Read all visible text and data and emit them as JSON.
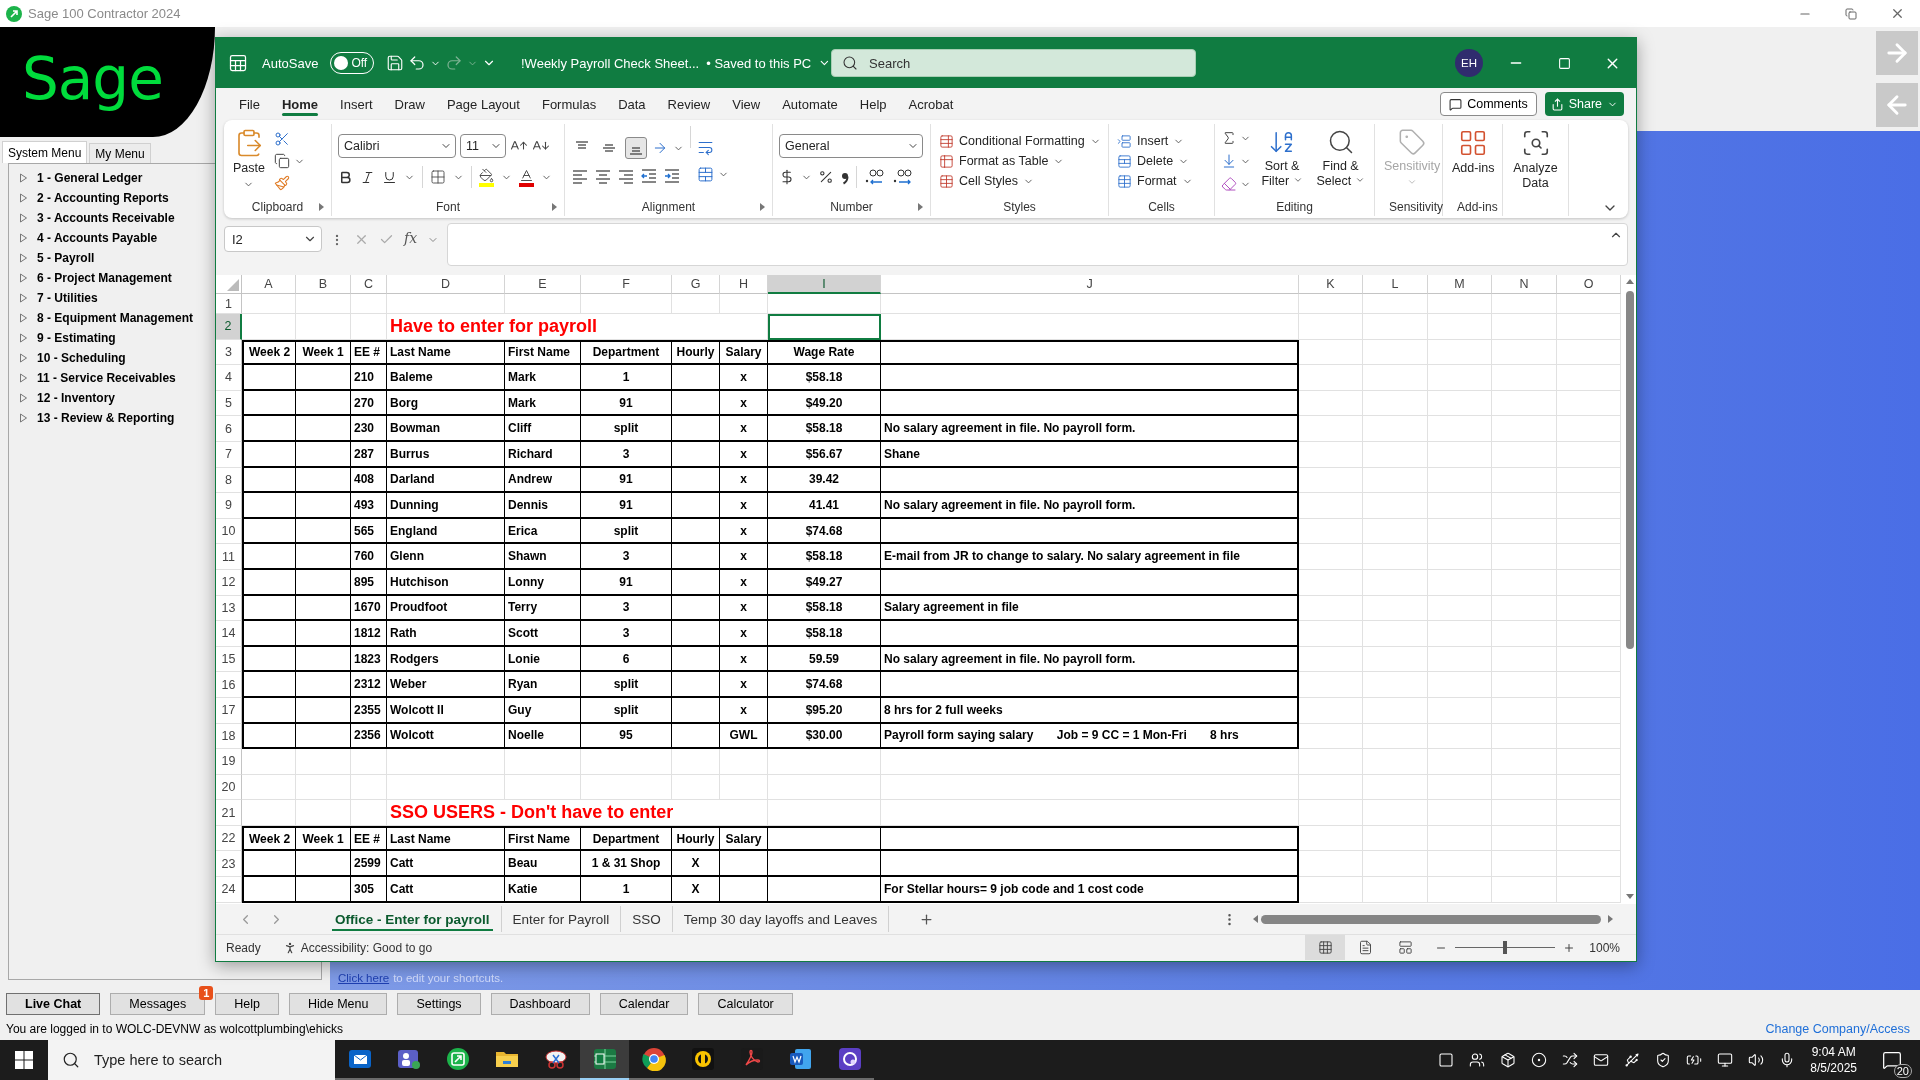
{
  "sage": {
    "title": "Sage 100 Contractor 2024",
    "logo": "Sage",
    "menu_tabs": [
      {
        "label": "System Menu",
        "selected": true
      },
      {
        "label": "My Menu",
        "selected": false
      }
    ],
    "menu_items": [
      {
        "label": "1 - General Ledger",
        "expanded": false
      },
      {
        "label": "2 - Accounting Reports",
        "expanded": false
      },
      {
        "label": "3 - Accounts Receivable",
        "expanded": false
      },
      {
        "label": "4 - Accounts Payable",
        "expanded": false
      },
      {
        "label": "5 - Payroll",
        "expanded": false
      },
      {
        "label": "6 - Project Management",
        "expanded": false
      },
      {
        "label": "7 - Utilities",
        "expanded": false
      },
      {
        "label": "8 - Equipment Management",
        "expanded": false
      },
      {
        "label": "9 - Estimating",
        "expanded": false
      },
      {
        "label": "10 - Scheduling",
        "expanded": false
      },
      {
        "label": "11 - Service Receivables",
        "expanded": false
      },
      {
        "label": "12 - Inventory",
        "expanded": false
      },
      {
        "label": "13 - Review & Reporting",
        "expanded": false
      }
    ],
    "shortcuts_hint": {
      "link": "Click here",
      "text": "to edit your shortcuts."
    },
    "buttons": [
      {
        "label": "Live Chat",
        "default": true
      },
      {
        "label": "Messages",
        "default": false,
        "badge": "1"
      },
      {
        "label": "Help",
        "default": false
      },
      {
        "label": "Hide Menu",
        "default": false
      },
      {
        "label": "Settings",
        "default": false
      },
      {
        "label": "Dashboard",
        "default": false
      },
      {
        "label": "Calendar",
        "default": false
      },
      {
        "label": "Calculator",
        "default": false
      }
    ],
    "login_status": "You are logged in to WOLC-DEVNW as wolcottplumbing\\ehicks",
    "change_company": "Change Company/Access"
  },
  "excel": {
    "autosave": {
      "label": "AutoSave",
      "on": false,
      "state": "Off"
    },
    "quick_access": [
      {
        "kind": "save",
        "disabled": false
      },
      {
        "kind": "undo",
        "disabled": false
      },
      {
        "kind": "redo",
        "disabled": true
      },
      {
        "kind": "customize",
        "disabled": false
      }
    ],
    "file_name": "!Weekly Payroll Check Sheet...",
    "save_status": "• Saved to this PC",
    "search": {
      "placeholder": "Search"
    },
    "avatar": "EH",
    "menu_tabs": [
      {
        "label": "File",
        "selected": false
      },
      {
        "label": "Home",
        "selected": true
      },
      {
        "label": "Insert",
        "selected": false
      },
      {
        "label": "Draw",
        "selected": false
      },
      {
        "label": "Page Layout",
        "selected": false
      },
      {
        "label": "Formulas",
        "selected": false
      },
      {
        "label": "Data",
        "selected": false
      },
      {
        "label": "Review",
        "selected": false
      },
      {
        "label": "View",
        "selected": false
      },
      {
        "label": "Automate",
        "selected": false
      },
      {
        "label": "Help",
        "selected": false
      },
      {
        "label": "Acrobat",
        "selected": false
      }
    ],
    "comments": "Comments",
    "share": "Share",
    "ribbon": {
      "paste": "Paste",
      "font_name": "Calibri",
      "font_size": "11",
      "vertical_align": [
        {
          "kind": "top",
          "selected": false
        },
        {
          "kind": "middle",
          "selected": false
        },
        {
          "kind": "bottom",
          "selected": true
        }
      ],
      "number_format": "General",
      "styles": [
        "Conditional Formatting",
        "Format as Table",
        "Cell Styles"
      ],
      "cells": [
        "Insert",
        "Delete",
        "Format"
      ],
      "sort_filter": "Sort & Filter",
      "find_select": "Find & Select",
      "sensitivity": {
        "label": "Sensitivity",
        "disabled": true
      },
      "addins": "Add-ins",
      "analyze": "Analyze Data",
      "groups": [
        "Clipboard",
        "Font",
        "Alignment",
        "Number",
        "Styles",
        "Cells",
        "Editing",
        "Sensitivity",
        "Add-ins"
      ]
    },
    "name_box": "I2",
    "function_label": "fx",
    "columns": [
      {
        "label": "A",
        "selected": false
      },
      {
        "label": "B",
        "selected": false
      },
      {
        "label": "C",
        "selected": false
      },
      {
        "label": "D",
        "selected": false
      },
      {
        "label": "E",
        "selected": false
      },
      {
        "label": "F",
        "selected": false
      },
      {
        "label": "G",
        "selected": false
      },
      {
        "label": "H",
        "selected": false
      },
      {
        "label": "I",
        "selected": true
      },
      {
        "label": "J",
        "selected": false
      },
      {
        "label": "K",
        "selected": false
      },
      {
        "label": "L",
        "selected": false
      },
      {
        "label": "M",
        "selected": false
      },
      {
        "label": "N",
        "selected": false
      },
      {
        "label": "O",
        "selected": false
      }
    ],
    "rows": [
      {
        "number": "1",
        "kind": "blank",
        "selected": false,
        "cells": {}
      },
      {
        "number": "2",
        "kind": "title",
        "selected": true,
        "cells": {
          "d": "Have to enter for payroll"
        }
      },
      {
        "number": "3",
        "kind": "header",
        "selected": false,
        "cells": {
          "a": "Week 2",
          "b": "Week 1",
          "c": "EE #",
          "d": "Last Name",
          "e": "First Name",
          "f": "Department",
          "g": "Hourly",
          "h": "Salary",
          "i": "Wage Rate"
        }
      },
      {
        "number": "4",
        "kind": "data",
        "selected": false,
        "cells": {
          "c": "210",
          "d": "Baleme",
          "e": "Mark",
          "f": "1",
          "h": "x",
          "i": "$58.18"
        }
      },
      {
        "number": "5",
        "kind": "data",
        "selected": false,
        "cells": {
          "c": "270",
          "d": "Borg",
          "e": "Mark",
          "f": "91",
          "h": "x",
          "i": "$49.20"
        }
      },
      {
        "number": "6",
        "kind": "data",
        "selected": false,
        "cells": {
          "c": "230",
          "d": "Bowman",
          "e": "Cliff",
          "f": "split",
          "h": "x",
          "i": "$58.18",
          "j": "No salary agreement in file. No payroll form."
        }
      },
      {
        "number": "7",
        "kind": "data",
        "selected": false,
        "cells": {
          "c": "287",
          "d": "Burrus",
          "e": "Richard",
          "f": "3",
          "h": "x",
          "i": "$56.67",
          "j": "Shane"
        }
      },
      {
        "number": "8",
        "kind": "data",
        "selected": false,
        "cells": {
          "c": "408",
          "d": "Darland",
          "e": "Andrew",
          "f": "91",
          "h": "x",
          "i": "39.42"
        }
      },
      {
        "number": "9",
        "kind": "data",
        "selected": false,
        "cells": {
          "c": "493",
          "d": "Dunning",
          "e": "Dennis",
          "f": "91",
          "h": "x",
          "i": "41.41",
          "j": "No salary agreement in file. No payroll form."
        }
      },
      {
        "number": "10",
        "kind": "data",
        "selected": false,
        "cells": {
          "c": "565",
          "d": "England",
          "e": "Erica",
          "f": "split",
          "h": "x",
          "i": "$74.68"
        }
      },
      {
        "number": "11",
        "kind": "data",
        "selected": false,
        "cells": {
          "c": "760",
          "d": "Glenn",
          "e": "Shawn",
          "f": "3",
          "h": "x",
          "i": "$58.18",
          "j": "E-mail from JR to change to salary. No salary agreement in file"
        }
      },
      {
        "number": "12",
        "kind": "data",
        "selected": false,
        "cells": {
          "c": "895",
          "d": "Hutchison",
          "e": "Lonny",
          "f": "91",
          "h": "x",
          "i": "$49.27"
        }
      },
      {
        "number": "13",
        "kind": "data",
        "selected": false,
        "cells": {
          "c": "1670",
          "d": "Proudfoot",
          "e": "Terry",
          "f": "3",
          "h": "x",
          "i": "$58.18",
          "j": "Salary agreement in file"
        }
      },
      {
        "number": "14",
        "kind": "data",
        "selected": false,
        "cells": {
          "c": "1812",
          "d": "Rath",
          "e": "Scott",
          "f": "3",
          "h": "x",
          "i": "$58.18"
        }
      },
      {
        "number": "15",
        "kind": "data",
        "selected": false,
        "cells": {
          "c": "1823",
          "d": "Rodgers",
          "e": "Lonie",
          "f": "6",
          "h": "x",
          "i": "59.59",
          "j": "No salary agreement in file. No payroll form."
        }
      },
      {
        "number": "16",
        "kind": "data",
        "selected": false,
        "cells": {
          "c": "2312",
          "d": "Weber",
          "e": "Ryan",
          "f": "split",
          "h": "x",
          "i": "$74.68"
        }
      },
      {
        "number": "17",
        "kind": "data",
        "selected": false,
        "cells": {
          "c": "2355",
          "d": "Wolcott II",
          "e": "Guy",
          "f": "split",
          "h": "x",
          "i": "$95.20",
          "j": "8 hrs for 2 full weeks"
        }
      },
      {
        "number": "18",
        "kind": "data",
        "selected": false,
        "cells": {
          "c": "2356",
          "d": "Wolcott",
          "e": "Noelle",
          "f": "95",
          "h": "GWL",
          "i": "$30.00",
          "j": "Payroll form saying salary       Job = 9 CC = 1 Mon-Fri       8 hrs"
        }
      },
      {
        "number": "19",
        "kind": "blank",
        "selected": false,
        "cells": {}
      },
      {
        "number": "20",
        "kind": "blank",
        "selected": false,
        "cells": {}
      },
      {
        "number": "21",
        "kind": "title",
        "selected": false,
        "cells": {
          "d": "SSO USERS - Don't have to enter"
        }
      },
      {
        "number": "22",
        "kind": "header",
        "selected": false,
        "cells": {
          "a": "Week 2",
          "b": "Week 1",
          "c": "EE #",
          "d": "Last Name",
          "e": "First Name",
          "f": "Department",
          "g": "Hourly",
          "h": "Salary"
        }
      },
      {
        "number": "23",
        "kind": "data",
        "selected": false,
        "cells": {
          "c": "2599",
          "d": "Catt",
          "e": "Beau",
          "f": "1 & 31 Shop",
          "g": "X"
        }
      },
      {
        "number": "24",
        "kind": "data",
        "selected": false,
        "cells": {
          "c": "305",
          "d": "Catt",
          "e": "Katie",
          "f": "1",
          "g": "X",
          "j": "For Stellar hours= 9 job code and 1 cost code"
        }
      }
    ],
    "sheet_tabs": [
      {
        "label": "Office - Enter for payroll",
        "selected": true
      },
      {
        "label": "Enter for Payroll",
        "selected": false
      },
      {
        "label": "SSO",
        "selected": false
      },
      {
        "label": "Temp 30 day layoffs and Leaves",
        "selected": false
      }
    ],
    "status": "Ready",
    "accessibility": "Accessibility: Good to go",
    "view_modes": [
      {
        "kind": "normal",
        "selected": true
      },
      {
        "kind": "page_layout",
        "selected": false
      },
      {
        "kind": "page_break",
        "selected": false
      }
    ],
    "zoom": {
      "level": 0.5,
      "label": "100%"
    }
  },
  "taskbar": {
    "search": {
      "placeholder": "Type here to search"
    },
    "apps": [
      {
        "active": false
      },
      {
        "active": false
      },
      {
        "active": false
      },
      {
        "active": false
      },
      {
        "active": false
      },
      {
        "active": true
      },
      {
        "active": false
      },
      {
        "active": false
      },
      {
        "active": false
      },
      {
        "active": false
      },
      {
        "active": false
      }
    ],
    "time": "9:04 AM",
    "date": "8/5/2025",
    "notifications": "20"
  }
}
